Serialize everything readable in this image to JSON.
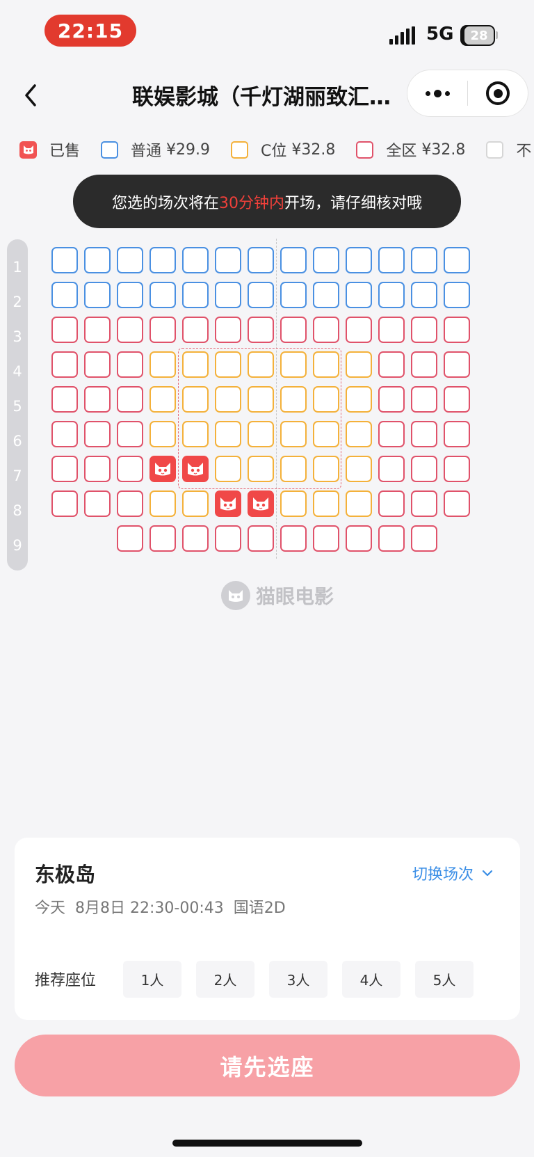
{
  "status_bar": {
    "time": "22:15",
    "network": "5G",
    "battery": "28"
  },
  "nav": {
    "title": "联娱影城（千灯湖丽致汇…"
  },
  "legend": [
    {
      "label": "已售",
      "price": "",
      "color": "#f15353",
      "type": "sold"
    },
    {
      "label": "普通",
      "price": "¥29.9",
      "color": "#4a90e2",
      "type": "normal"
    },
    {
      "label": "C位",
      "price": "¥32.8",
      "color": "#f4b13a",
      "type": "c-seat"
    },
    {
      "label": "全区",
      "price": "¥32.8",
      "color": "#e0526a",
      "type": "full-zone"
    },
    {
      "label": "不",
      "price": "",
      "color": "#d6d6d6",
      "type": "unavailable"
    }
  ],
  "toast": {
    "before": "您选的场次将在",
    "highlight": "30分钟内",
    "after": "开场，请仔细核对哦"
  },
  "seat_map": {
    "rows": [
      "1",
      "2",
      "3",
      "4",
      "5",
      "6",
      "7",
      "8",
      "9"
    ],
    "legend_key": {
      "n": "普通",
      "c": "C位",
      "q": "全区",
      "s": "已售"
    },
    "seats": [
      [
        "n",
        "n",
        "n",
        "n",
        "n",
        "n",
        "n",
        "n",
        "n",
        "n",
        "n",
        "n",
        "n"
      ],
      [
        "n",
        "n",
        "n",
        "n",
        "n",
        "n",
        "n",
        "n",
        "n",
        "n",
        "n",
        "n",
        "n"
      ],
      [
        "q",
        "q",
        "q",
        "q",
        "q",
        "q",
        "q",
        "q",
        "q",
        "q",
        "q",
        "q",
        "q"
      ],
      [
        "q",
        "q",
        "q",
        "c",
        "c",
        "c",
        "c",
        "c",
        "c",
        "c",
        "q",
        "q",
        "q"
      ],
      [
        "q",
        "q",
        "q",
        "c",
        "c",
        "c",
        "c",
        "c",
        "c",
        "c",
        "q",
        "q",
        "q"
      ],
      [
        "q",
        "q",
        "q",
        "c",
        "c",
        "c",
        "c",
        "c",
        "c",
        "c",
        "q",
        "q",
        "q"
      ],
      [
        "q",
        "q",
        "q",
        "s",
        "s",
        "c",
        "c",
        "c",
        "c",
        "c",
        "q",
        "q",
        "q"
      ],
      [
        "q",
        "q",
        "q",
        "c",
        "c",
        "s",
        "s",
        "c",
        "c",
        "c",
        "q",
        "q",
        "q"
      ],
      [
        "",
        "",
        "q",
        "q",
        "q",
        "q",
        "q",
        "q",
        "q",
        "q",
        "q",
        "q",
        ""
      ]
    ],
    "watermark": "猫眼电影"
  },
  "show": {
    "movie": "东极岛",
    "switch_label": "切换场次",
    "day": "今天",
    "date_time": "8月8日 22:30-00:43",
    "format": "国语2D"
  },
  "recommend": {
    "label": "推荐座位",
    "options": [
      "1人",
      "2人",
      "3人",
      "4人",
      "5人"
    ]
  },
  "cta": {
    "label": "请先选座"
  }
}
